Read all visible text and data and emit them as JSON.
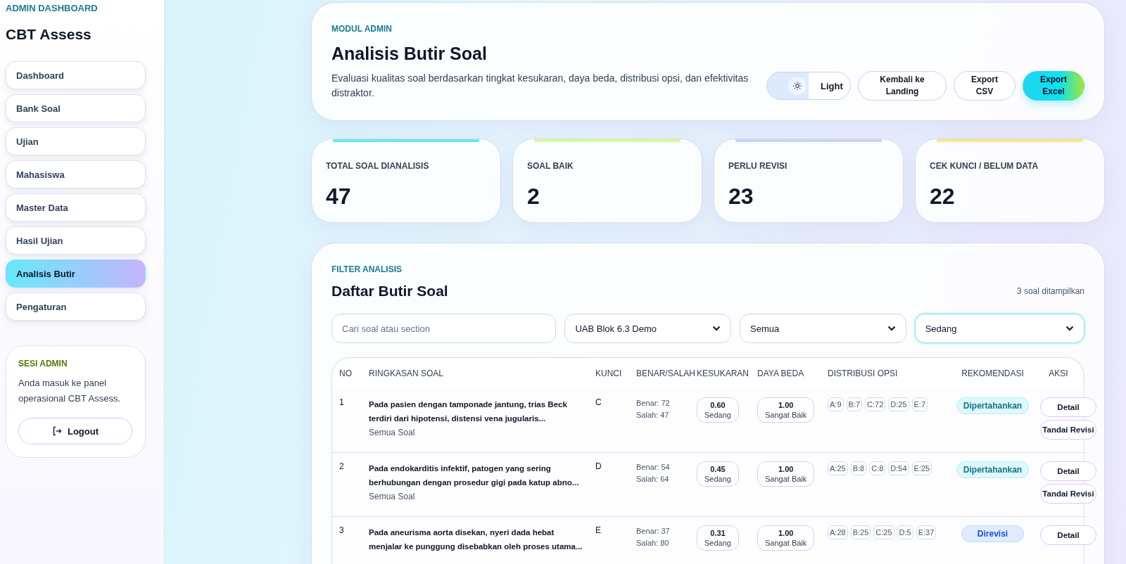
{
  "sidebar": {
    "eyebrow": "ADMIN DASHBOARD",
    "title": "CBT Assess",
    "items": [
      {
        "label": "Dashboard",
        "selected": false
      },
      {
        "label": "Bank Soal",
        "selected": false
      },
      {
        "label": "Ujian",
        "selected": false
      },
      {
        "label": "Mahasiswa",
        "selected": false
      },
      {
        "label": "Master Data",
        "selected": false
      },
      {
        "label": "Hasil Ujian",
        "selected": false
      },
      {
        "label": "Analisis Butir",
        "selected": true
      },
      {
        "label": "Pengaturan",
        "selected": false
      }
    ],
    "session": {
      "eyebrow": "SESI ADMIN",
      "text": "Anda masuk ke panel operasional CBT Assess.",
      "button": "Logout"
    }
  },
  "header": {
    "eyebrow": "MODUL ADMIN",
    "title": "Analisis Butir Soal",
    "description": "Evaluasi kualitas soal berdasarkan tingkat kesukaran, daya beda, distribusi opsi, dan efektivitas distraktor.",
    "theme_toggle": {
      "label": "Light"
    },
    "buttons": [
      {
        "label": "Kembali ke Landing",
        "kind": "outline"
      },
      {
        "label": "Export CSV",
        "kind": "outline"
      },
      {
        "label": "Export Excel",
        "kind": "primary"
      }
    ]
  },
  "stats": [
    {
      "label": "TOTAL SOAL DIANALISIS",
      "value": "47",
      "color": "#67e8f9"
    },
    {
      "label": "SOAL BAIK",
      "value": "2",
      "color": "#d9f99d"
    },
    {
      "label": "PERLU REVISI",
      "value": "23",
      "color": "#c7d2fe"
    },
    {
      "label": "CEK KUNCI / BELUM DATA",
      "value": "22",
      "color": "#fde68a"
    }
  ],
  "filter": {
    "eyebrow": "FILTER ANALISIS",
    "title": "Daftar Butir Soal",
    "count": "3 soal ditampilkan",
    "search": {
      "placeholder": "Cari soal atau section"
    },
    "selects": [
      {
        "value": "UAB Blok 6.3 Demo",
        "focused": false
      },
      {
        "value": "Semua",
        "focused": false
      },
      {
        "value": "Sedang",
        "focused": true
      }
    ]
  },
  "table": {
    "columns": [
      "NO",
      "RINGKASAN SOAL",
      "KUNCI",
      "BENAR/SALAH",
      "KESUKARAN",
      "DAYA BEDA",
      "DISTRIBUSI OPSI",
      "REKOMENDASI",
      "AKSI"
    ],
    "rows": [
      {
        "no": "1",
        "summary": "Pada pasien dengan tamponade jantung, trias Beck terdiri dari hipotensi, distensi vena jugularis...",
        "section": "Semua Soal",
        "key": "C",
        "correct": "Benar: 72",
        "wrong": "Salah: 47",
        "difficulty": {
          "value": "0.60",
          "label": "Sedang"
        },
        "discrimination": {
          "value": "1.00",
          "label": "Sangat Baik"
        },
        "options": [
          "A:9",
          "B:7",
          "C:72",
          "D:25",
          "E:7"
        ],
        "recommendation": {
          "label": "Dipertahankan",
          "kind": "keep"
        },
        "actions": [
          "Detail",
          "Tandai Revisi"
        ]
      },
      {
        "no": "2",
        "summary": "Pada endokarditis infektif, patogen yang sering berhubungan dengan prosedur gigi pada katup abno...",
        "section": "Semua Soal",
        "key": "D",
        "correct": "Benar: 54",
        "wrong": "Salah: 64",
        "difficulty": {
          "value": "0.45",
          "label": "Sedang"
        },
        "discrimination": {
          "value": "1.00",
          "label": "Sangat Baik"
        },
        "options": [
          "A:25",
          "B:8",
          "C:8",
          "D:54",
          "E:25"
        ],
        "recommendation": {
          "label": "Dipertahankan",
          "kind": "keep"
        },
        "actions": [
          "Detail",
          "Tandai Revisi"
        ]
      },
      {
        "no": "3",
        "summary": "Pada aneurisma aorta disekan, nyeri dada hebat menjalar ke punggung disebabkan oleh proses utama...",
        "key": "E",
        "correct": "Benar: 37",
        "wrong": "Salah: 80",
        "difficulty": {
          "value": "0.31",
          "label": "Sedang"
        },
        "discrimination": {
          "value": "1.00",
          "label": "Sangat Baik"
        },
        "options": [
          "A:28",
          "B:25",
          "C:25",
          "D:5",
          "E:37"
        ],
        "recommendation": {
          "label": "Direvisi",
          "kind": "revise"
        },
        "actions": [
          "Detail"
        ]
      }
    ]
  }
}
